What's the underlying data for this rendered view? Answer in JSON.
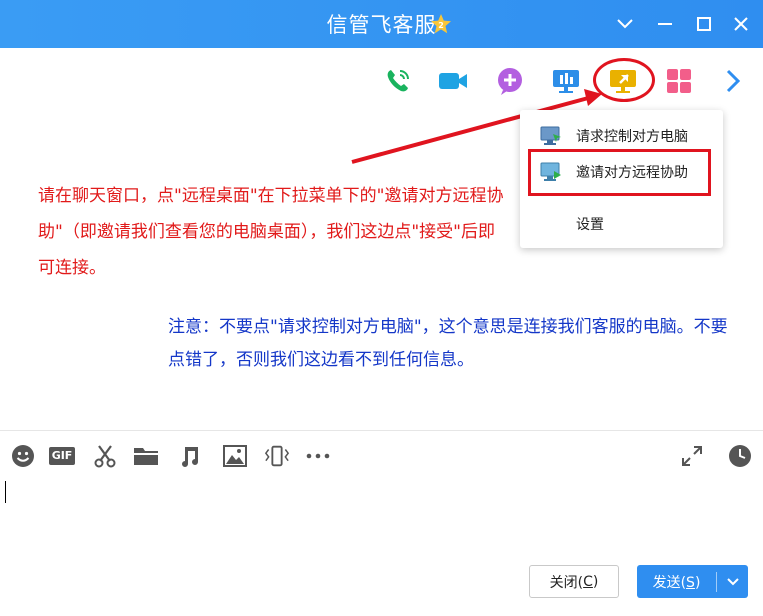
{
  "window": {
    "title": "信管飞客服",
    "badge_icon": "level-star-badge-icon",
    "controls": [
      "chevron-down-icon",
      "minimize-icon",
      "maximize-icon",
      "close-icon"
    ]
  },
  "toolbar": {
    "icons": [
      "phone-call-icon",
      "video-call-icon",
      "add-member-icon",
      "screen-share-icon",
      "remote-desktop-icon",
      "apps-grid-icon",
      "chevron-right-icon"
    ]
  },
  "dropdown": {
    "items": [
      {
        "label": "请求控制对方电脑",
        "icon": "request-control-icon"
      },
      {
        "label": "邀请对方远程协助",
        "icon": "invite-assist-icon"
      },
      {
        "label": "设置",
        "icon": ""
      }
    ]
  },
  "annotations": {
    "red_text": "请在聊天窗口，点\"远程桌面\"在下拉菜单下的\"邀请对方远程协助\"（即邀请我们查看您的电脑桌面），我们这边点\"接受\"后即可连接。",
    "blue_text": "注意：不要点\"请求控制对方电脑\"，这个意思是连接我们客服的电脑。不要点错了，否则我们这边看不到任何信息。"
  },
  "input_toolbar": {
    "icons": [
      "emoji-icon",
      "gif-icon",
      "scissors-icon",
      "folder-icon",
      "music-icon",
      "image-icon",
      "shake-icon",
      "more-icon",
      "expand-icon",
      "history-clock-icon"
    ],
    "gif_text": "GIF"
  },
  "buttons": {
    "close_label": "关闭(",
    "close_key": "C",
    "close_end": ")",
    "send_label": "发送(",
    "send_key": "S",
    "send_end": ")"
  },
  "colors": {
    "title_bar": "#2f8ef0",
    "red": "#e0141f",
    "blue_text": "#1437c8",
    "send_button": "#2f8ef0"
  }
}
